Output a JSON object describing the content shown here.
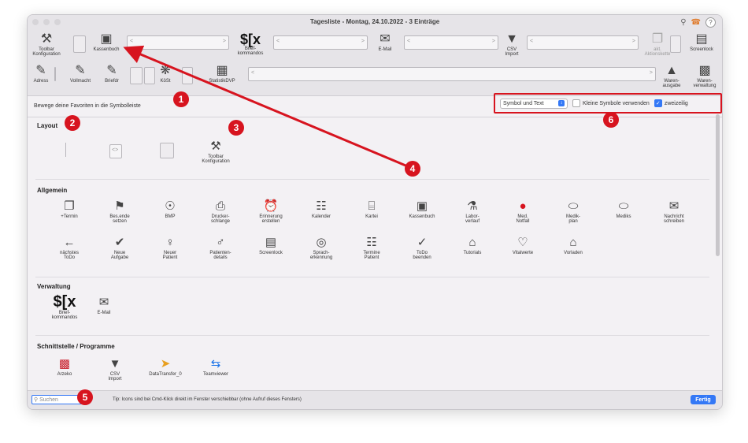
{
  "window": {
    "title": "Tagesliste - Montag, 24.10.2022 - 3 Einträge"
  },
  "toolbar_row1": [
    {
      "label": "Toolbar\nKonfiguration",
      "icon": "tools-icon"
    },
    {
      "label": "Kassenbuch",
      "icon": "cash-register-icon"
    },
    {
      "label": "Brief-\nkommandos",
      "icon": "brief-command-icon"
    },
    {
      "label": "E-Mail",
      "icon": "mail-icon"
    },
    {
      "label": "CSV\nImport",
      "icon": "csv-import-icon"
    },
    {
      "label": "akt.\nAktionskette",
      "icon": "action-chain-icon"
    },
    {
      "label": "Screenlock",
      "icon": "screenlock-icon"
    }
  ],
  "toolbar_row2": [
    {
      "label": "Adress",
      "icon": "address-icon"
    },
    {
      "label": "Vollmacht",
      "icon": "power-of-attorney-icon"
    },
    {
      "label": "Briefdr",
      "icon": "letter-print-icon"
    },
    {
      "label": "KöSt",
      "icon": "koest-icon"
    },
    {
      "label": "StatistikDVP",
      "icon": "statistics-icon"
    },
    {
      "label": "Waren-\nausgabe",
      "icon": "goods-issue-icon"
    },
    {
      "label": "Waren-\nverwaltung",
      "icon": "goods-management-icon"
    }
  ],
  "info": {
    "hint": "Bewege deine Favoriten in die Symbolleiste"
  },
  "options": {
    "display_mode": "Symbol und Text",
    "small_icons_label": "Kleine Symbole verwenden",
    "small_icons_checked": false,
    "two_rows_label": "zweizeilig",
    "two_rows_checked": true
  },
  "sections": {
    "layout": {
      "title": "Layout",
      "items": [
        {
          "label": "Toolbar\nKonfiguration",
          "icon": "tools-icon"
        }
      ]
    },
    "allgemein": {
      "title": "Allgemein",
      "items": [
        {
          "label": "+Termin",
          "icon": "calendar-add-icon"
        },
        {
          "label": "Bes.ende\nsetzen",
          "icon": "finish-flag-icon"
        },
        {
          "label": "BMP",
          "icon": "bmp-icon"
        },
        {
          "label": "Drucker-\nschlange",
          "icon": "printer-queue-icon"
        },
        {
          "label": "Erinnerung\nerstellen",
          "icon": "alarm-icon"
        },
        {
          "label": "Kalender",
          "icon": "calendar-icon"
        },
        {
          "label": "Kartei",
          "icon": "clipboard-icon"
        },
        {
          "label": "Kassenbuch",
          "icon": "cash-register-icon"
        },
        {
          "label": "Labor-\nverlauf",
          "icon": "lab-flask-icon"
        },
        {
          "label": "Med.\nNotfall",
          "icon": "sos-icon"
        },
        {
          "label": "Medik-\nplan",
          "icon": "pills-icon"
        },
        {
          "label": "Mediks",
          "icon": "pills-icon"
        },
        {
          "label": "Nachricht\nschreiben",
          "icon": "message-icon"
        },
        {
          "label": "nächstes\nToDo",
          "icon": "next-arrow-icon"
        },
        {
          "label": "Neue\nAufgabe",
          "icon": "new-task-icon"
        },
        {
          "label": "Neuer\nPatient",
          "icon": "new-patient-icon"
        },
        {
          "label": "Patienten-\ndetails",
          "icon": "patient-details-icon"
        },
        {
          "label": "Screenlock",
          "icon": "screenlock-icon"
        },
        {
          "label": "Sprach-\nerkennung",
          "icon": "microphone-icon"
        },
        {
          "label": "Termine\nPatient",
          "icon": "calendar-patient-icon"
        },
        {
          "label": "ToDo\nbeenden",
          "icon": "check-circle-icon"
        },
        {
          "label": "Tutorials",
          "icon": "graduation-cap-icon"
        },
        {
          "label": "Vitalwerte",
          "icon": "heartbeat-icon"
        },
        {
          "label": "Vorladen",
          "icon": "house-upload-icon"
        }
      ]
    },
    "verwaltung": {
      "title": "Verwaltung",
      "items": [
        {
          "label": "Brief-\nkommandos",
          "icon": "brief-command-icon"
        },
        {
          "label": "E-Mail",
          "icon": "mail-icon"
        }
      ]
    },
    "schnittstelle": {
      "title": "Schnittstelle / Programme",
      "items": [
        {
          "label": "Arzeko",
          "icon": "arzeko-icon"
        },
        {
          "label": "CSV\nImport",
          "icon": "csv-import-icon"
        },
        {
          "label": "DataTransfer_0",
          "icon": "data-transfer-icon"
        },
        {
          "label": "Teamviewer",
          "icon": "teamviewer-icon"
        }
      ]
    }
  },
  "bottom": {
    "search_placeholder": "Suchen",
    "tip": "Tip: Icons sind bei Cmd-Klick direkt im Fenster verschiebbar (ohne Aufruf dieses Fensters)",
    "done_label": "Fertig"
  },
  "badges": [
    "1",
    "2",
    "3",
    "4",
    "5",
    "6"
  ],
  "colors": {
    "accent": "#3478f6",
    "annotation": "#d7141f"
  }
}
